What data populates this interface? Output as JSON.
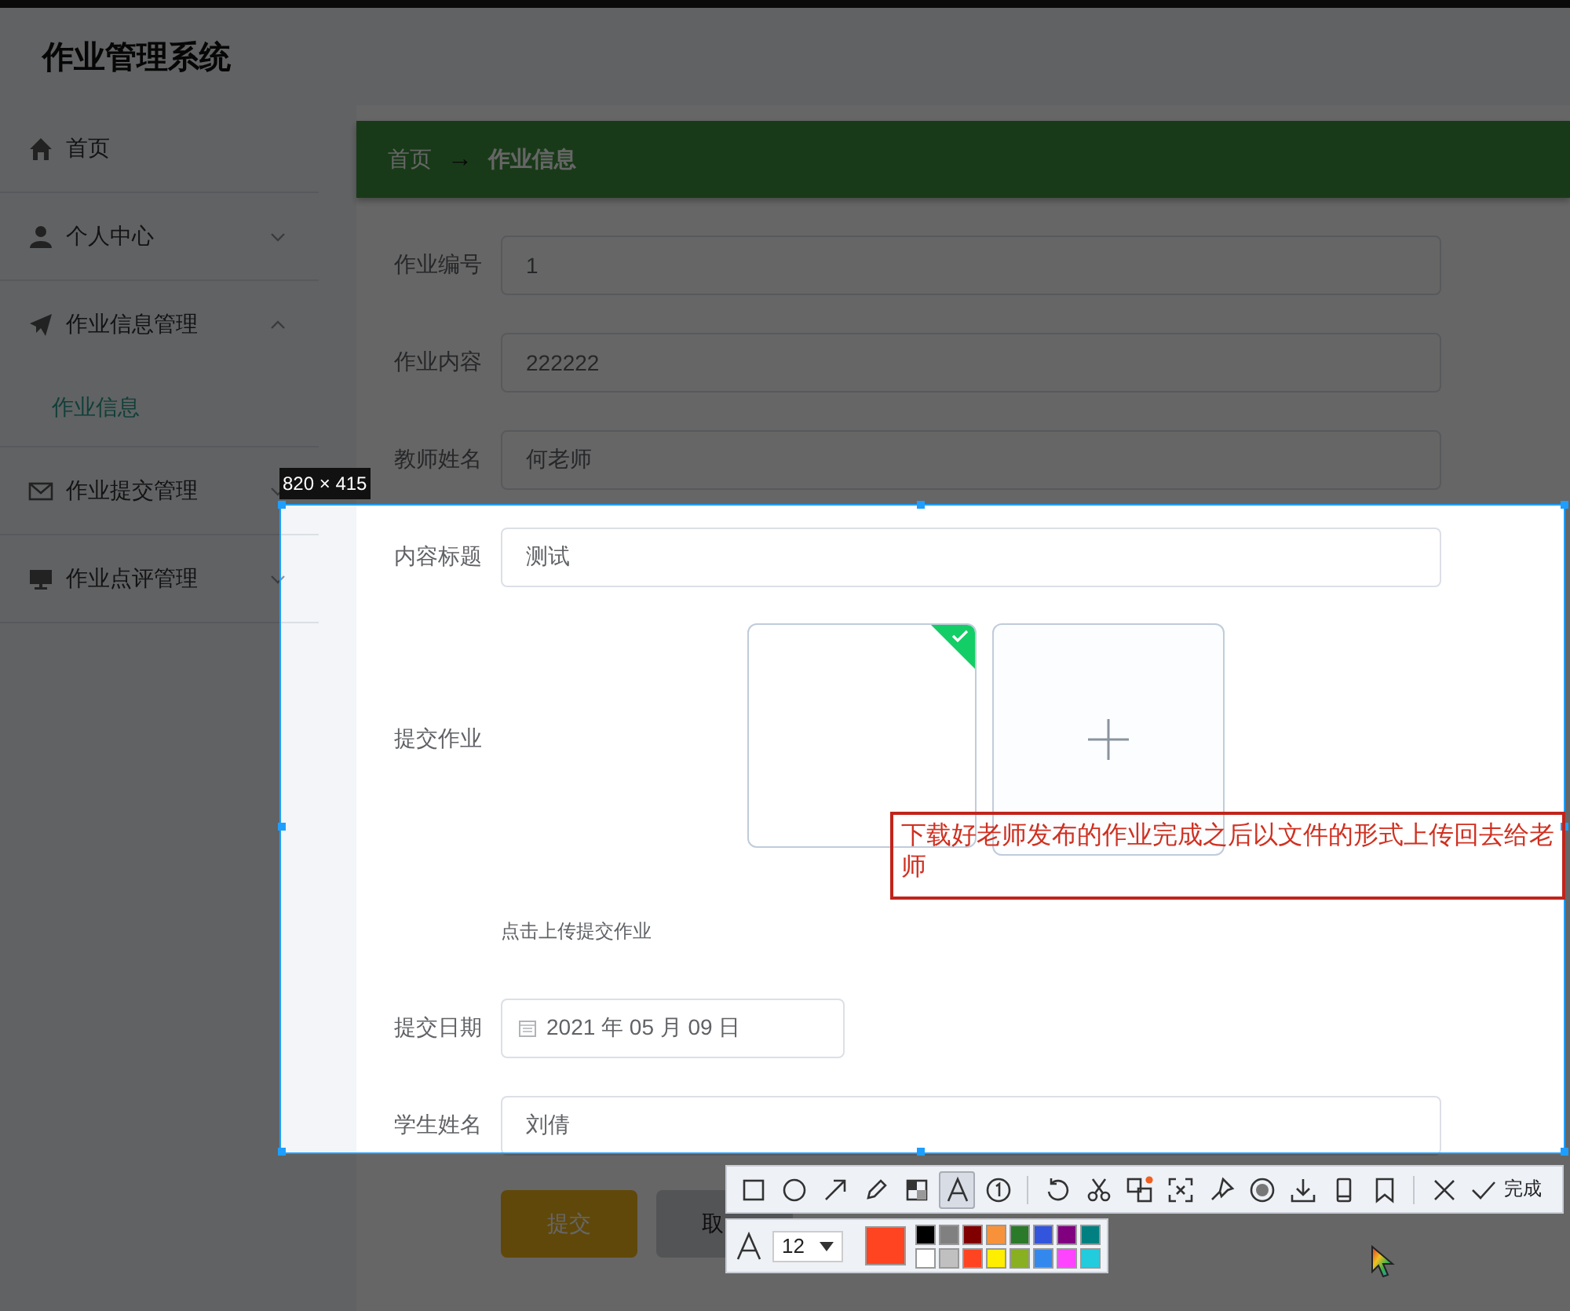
{
  "app_title": "作业管理系统",
  "sidebar": {
    "items": [
      {
        "label": "首页",
        "kind": "link"
      },
      {
        "label": "个人中心",
        "kind": "group",
        "expanded": false
      },
      {
        "label": "作业信息管理",
        "kind": "group",
        "expanded": true,
        "children": [
          {
            "label": "作业信息",
            "selected": true
          }
        ]
      },
      {
        "label": "作业提交管理",
        "kind": "group",
        "expanded": false
      },
      {
        "label": "作业点评管理",
        "kind": "group",
        "expanded": false
      }
    ]
  },
  "breadcrumb": {
    "items": [
      "首页",
      "作业信息"
    ],
    "separator": "→"
  },
  "form": {
    "fields": [
      {
        "label": "作业编号",
        "kind": "text",
        "value": "1"
      },
      {
        "label": "作业内容",
        "kind": "text",
        "value": "222222"
      },
      {
        "label": "教师姓名",
        "kind": "text",
        "value": "何老师"
      },
      {
        "label": "内容标题",
        "kind": "text",
        "value": "测试"
      },
      {
        "label": "提交作业",
        "kind": "upload",
        "hint": "点击上传提交作业"
      },
      {
        "label": "提交日期",
        "kind": "date",
        "value": "2021 年 05 月 09 日"
      },
      {
        "label": "学生姓名",
        "kind": "text",
        "value": "刘倩"
      }
    ],
    "buttons": [
      {
        "label": "提交",
        "kind": "primary"
      },
      {
        "label": "取",
        "kind": "default"
      }
    ]
  },
  "capture": {
    "size": "820 × 415",
    "annotation": "下载好老师发布的作业完成之后以文件的形式上传回去给老师",
    "toolbar": {
      "tool_groups": [
        [
          {
            "kind": "rectangle",
            "selected": false
          },
          {
            "kind": "ellipse",
            "selected": false
          },
          {
            "kind": "arrow",
            "selected": false
          },
          {
            "kind": "pencil",
            "selected": false
          },
          {
            "kind": "mosaic",
            "selected": false
          },
          {
            "kind": "text",
            "selected": true
          },
          {
            "kind": "number",
            "selected": false
          }
        ],
        [
          {
            "kind": "undo",
            "selected": false
          },
          {
            "kind": "cut",
            "selected": false
          },
          {
            "kind": "translate",
            "selected": false
          },
          {
            "kind": "ocr",
            "selected": false
          },
          {
            "kind": "pin",
            "selected": false
          },
          {
            "kind": "record",
            "selected": false
          },
          {
            "kind": "download",
            "selected": false
          },
          {
            "kind": "phone",
            "selected": false
          },
          {
            "kind": "bookmark",
            "selected": false
          }
        ],
        [
          {
            "kind": "close",
            "selected": false
          }
        ]
      ],
      "done": "完成"
    },
    "text_options": {
      "font_size": "12",
      "color": "#ff4422",
      "palette": [
        {
          "color": "#000000"
        },
        {
          "color": "#808080"
        },
        {
          "color": "#800000"
        },
        {
          "color": "#f7923a"
        },
        {
          "color": "#2a7a2a"
        },
        {
          "color": "#3355dd"
        },
        {
          "color": "#800080"
        },
        {
          "color": "#008080"
        },
        {
          "color": "#ffffff"
        },
        {
          "color": "#c0c0c0"
        },
        {
          "color": "#ff4422"
        },
        {
          "color": "#ffee00"
        },
        {
          "color": "#88b020"
        },
        {
          "color": "#3388ee"
        },
        {
          "color": "#ff44ff"
        },
        {
          "color": "#22ccdd"
        }
      ]
    }
  }
}
